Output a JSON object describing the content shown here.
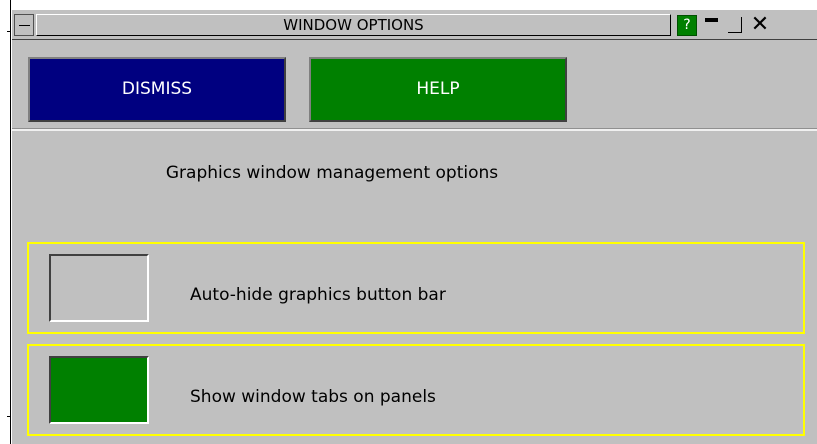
{
  "window": {
    "title": "WINDOW OPTIONS",
    "help_symbol": "?",
    "close_symbol": "✕"
  },
  "buttons": {
    "dismiss_label": "DISMISS",
    "help_label": "HELP"
  },
  "heading": "Graphics window management options",
  "options": [
    {
      "label": "Auto-hide graphics button bar",
      "checked": false
    },
    {
      "label": "Show window tabs on panels",
      "checked": true
    }
  ],
  "colors": {
    "panel_background": "#c0c0c0",
    "dismiss_button": "#000080",
    "help_button": "#008000",
    "option_border": "#ffff00",
    "toggle_on": "#008000"
  }
}
